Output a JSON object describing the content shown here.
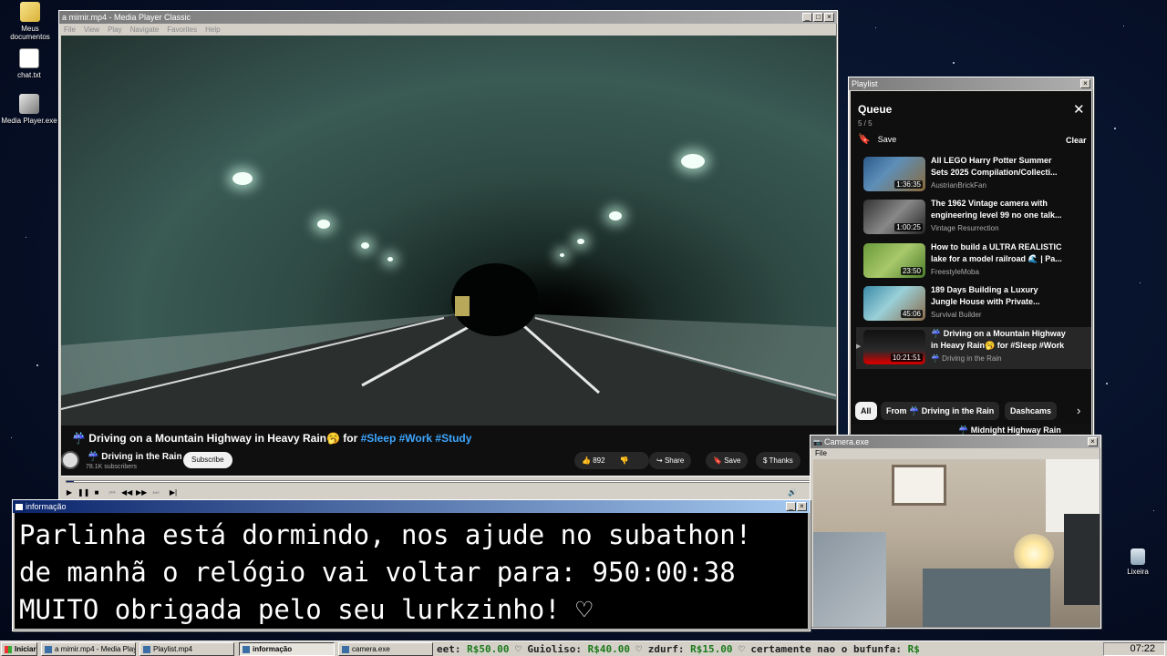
{
  "desktop": {
    "icons": [
      "Meus documentos",
      "chat.txt",
      "Media Player.exe"
    ],
    "trash": "Lixeira"
  },
  "player": {
    "title": "a mimir.mp4 - Media Player Classic",
    "menu": [
      "File",
      "View",
      "Play",
      "Navigate",
      "Favorites",
      "Help"
    ],
    "video_title": "☔ Driving on a Mountain Highway in Heavy Rain🥱 for",
    "video_tags": "#Sleep #Work #Study",
    "channel": "☔ Driving in the Rain",
    "subscribers": "78.1K subscribers",
    "subscribe": "Subscribe",
    "likes": "892",
    "share": "Share",
    "save": "Save",
    "thanks": "Thanks",
    "progress": 0.01
  },
  "playlist": {
    "window_title": "Playlist",
    "queue_title": "Queue",
    "count": "5 / 5",
    "save": "Save",
    "clear": "Clear",
    "items": [
      {
        "title": "All LEGO Harry Potter Summer Sets 2025 Compilation/Collecti...",
        "channel": "AustrianBrickFan",
        "duration": "1:36:35"
      },
      {
        "title": "The 1962 Vintage camera with engineering level 99 no one talk...",
        "channel": "Vintage Resurrection",
        "duration": "1:00:25"
      },
      {
        "title": "How to build a ULTRA REALISTIC lake for a model railroad 🌊 | Pa...",
        "channel": "FreestyleMoba",
        "duration": "23:50"
      },
      {
        "title": "189 Days Building a Luxury Jungle House with Private...",
        "channel": "Survival Builder",
        "duration": "45:06"
      },
      {
        "title": "☔ Driving on a Mountain Highway in Heavy Rain🥱 for #Sleep #Work #Study",
        "channel": "☔ Driving in the Rain",
        "duration": "10:21:51"
      }
    ],
    "chips": [
      "All",
      "From ☔ Driving in the Rain",
      "Dashcams"
    ],
    "next_title": "☔ Midnight Highway Rain"
  },
  "info": {
    "title": "informação",
    "lines": [
      "Parlinha está dormindo, nos ajude no subathon!",
      "de manhã o relógio vai voltar para:  950:00:38",
      "MUITO obrigada pelo seu lurkzinho! ♡"
    ]
  },
  "camera": {
    "title": "Camera.exe",
    "menu": "File"
  },
  "taskbar": {
    "start": "Iniciar",
    "items": [
      "a mimir.mp4 - Media Playe...",
      "Playlist.mp4",
      "informação",
      "camera.exe"
    ],
    "ticker": [
      {
        "text": "eet: ",
        "amt": "R$50.00"
      },
      {
        "text": " ♡ Guioliso: ",
        "amt": "R$40.00"
      },
      {
        "text": " ♡ zdurf: ",
        "amt": "R$15.00"
      },
      {
        "text": " ♡ certamente nao o bufunfa: ",
        "amt": "R$"
      }
    ],
    "clock": "07:22"
  }
}
